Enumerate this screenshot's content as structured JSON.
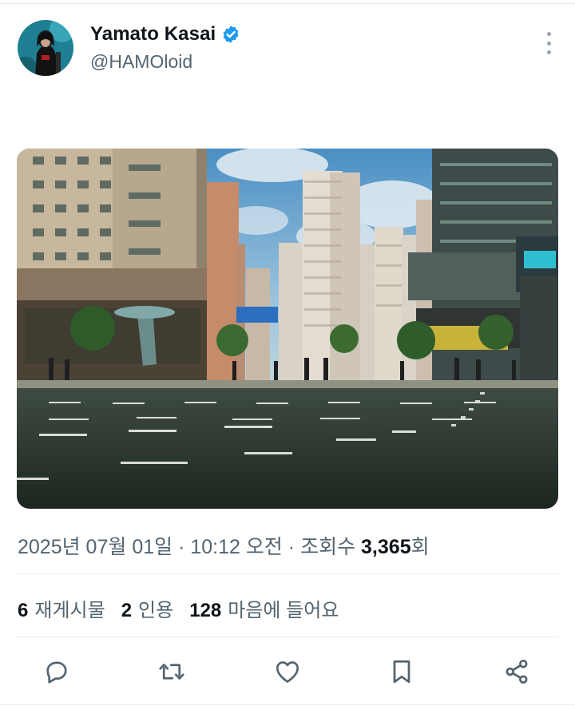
{
  "author": {
    "display_name": "Yamato Kasai",
    "handle": "@HAMOloid",
    "verified": true,
    "avatar_icon": "profile-photo"
  },
  "media": {
    "kind": "photo",
    "scene": "city-street-crosswalk-high-rises"
  },
  "meta": {
    "date": "2025년 07월 01일",
    "separator": " · ",
    "time": "10:12 오전",
    "views_label": "조회수 ",
    "views_count": "3,365",
    "views_suffix": "회"
  },
  "stats": {
    "reposts_count": "6",
    "reposts_label": "재게시물",
    "quotes_count": "2",
    "quotes_label": "인용",
    "likes_count": "128",
    "likes_label": "마음에 들어요"
  },
  "actions": [
    "reply-icon",
    "repost-icon",
    "like-icon",
    "bookmark-icon",
    "share-icon"
  ],
  "colors": {
    "text_primary": "#0f1419",
    "text_secondary": "#536471",
    "verified_blue": "#1d9bf0",
    "divider": "#e6e9eb"
  }
}
